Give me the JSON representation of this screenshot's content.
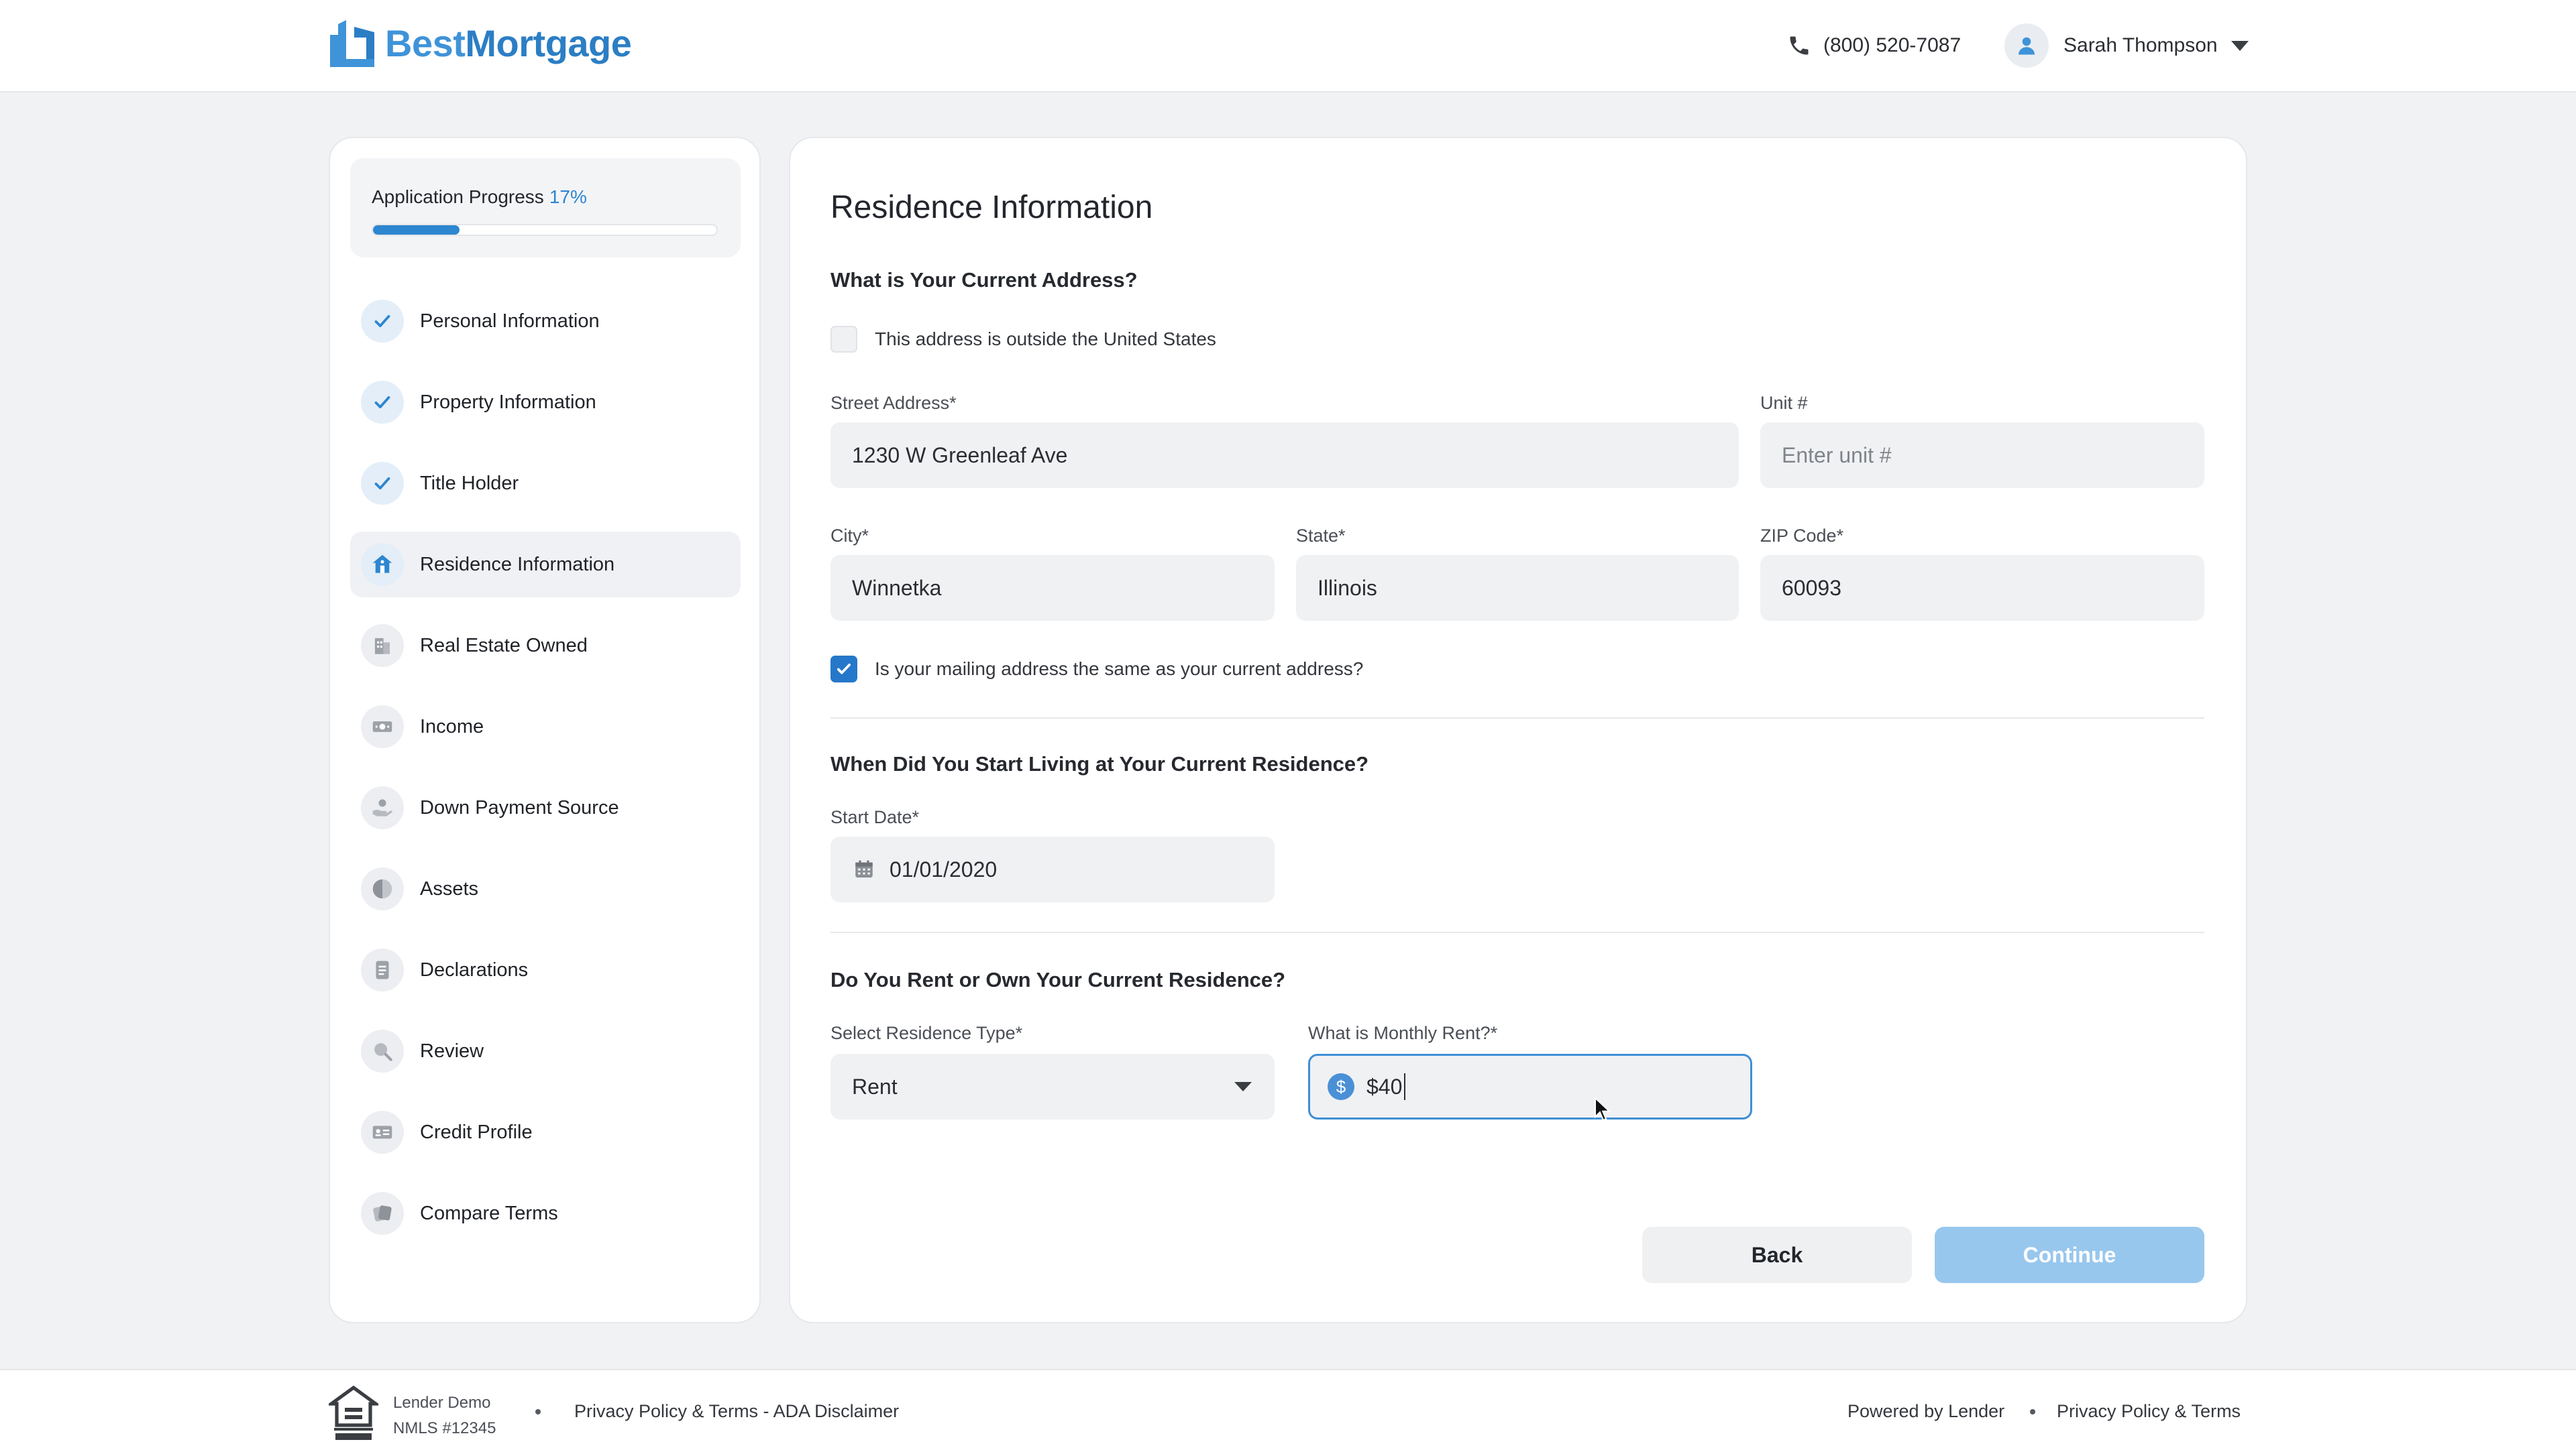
{
  "header": {
    "brand_part1": "Best",
    "brand_part2": "Mortgage",
    "phone": "(800) 520-7087",
    "user_name": "Sarah Thompson"
  },
  "progress": {
    "label": "Application Progress",
    "percent_text": "17%",
    "percent_value": 17
  },
  "steps": [
    {
      "label": "Personal Information",
      "status": "done",
      "icon": "check-icon"
    },
    {
      "label": "Property Information",
      "status": "done",
      "icon": "check-icon"
    },
    {
      "label": "Title Holder",
      "status": "done",
      "icon": "check-icon"
    },
    {
      "label": "Residence Information",
      "status": "current",
      "icon": "house-icon"
    },
    {
      "label": "Real Estate Owned",
      "status": "pending",
      "icon": "building-icon"
    },
    {
      "label": "Income",
      "status": "pending",
      "icon": "cash-icon"
    },
    {
      "label": "Down Payment Source",
      "status": "pending",
      "icon": "hand-coin-icon"
    },
    {
      "label": "Assets",
      "status": "pending",
      "icon": "pie-chart-icon"
    },
    {
      "label": "Declarations",
      "status": "pending",
      "icon": "document-icon"
    },
    {
      "label": "Review",
      "status": "pending",
      "icon": "magnifier-icon"
    },
    {
      "label": "Credit Profile",
      "status": "pending",
      "icon": "id-card-icon"
    },
    {
      "label": "Compare Terms",
      "status": "pending",
      "icon": "compare-icon"
    }
  ],
  "main": {
    "title": "Residence Information",
    "address_section": "What is Your Current Address?",
    "outside_us_label": "This address is outside the United States",
    "street_label": "Street Address*",
    "street_value": "1230 W Greenleaf Ave",
    "unit_label": "Unit #",
    "unit_placeholder": "Enter unit #",
    "city_label": "City*",
    "city_value": "Winnetka",
    "state_label": "State*",
    "state_value": "Illinois",
    "zip_label": "ZIP Code*",
    "zip_value": "60093",
    "mailing_same_label": "Is your mailing address the same as your current address?",
    "start_section": "When Did You Start Living at Your Current Residence?",
    "start_label": "Start Date*",
    "start_value": "01/01/2020",
    "rent_section": "Do You Rent or Own Your Current Residence?",
    "type_label": "Select Residence Type*",
    "type_value": "Rent",
    "rent_label": "What is Monthly Rent?*",
    "rent_value": "$40",
    "back_label": "Back",
    "continue_label": "Continue"
  },
  "footer": {
    "lender_name": "Lender Demo",
    "nmls": "NMLS #12345",
    "links_left": "Privacy Policy & Terms - ADA Disclaimer",
    "powered_by": "Powered by Lender",
    "links_right": "Privacy Policy & Terms"
  },
  "colors": {
    "accent": "#2d86d0",
    "continue_disabled": "#98c7ee"
  }
}
